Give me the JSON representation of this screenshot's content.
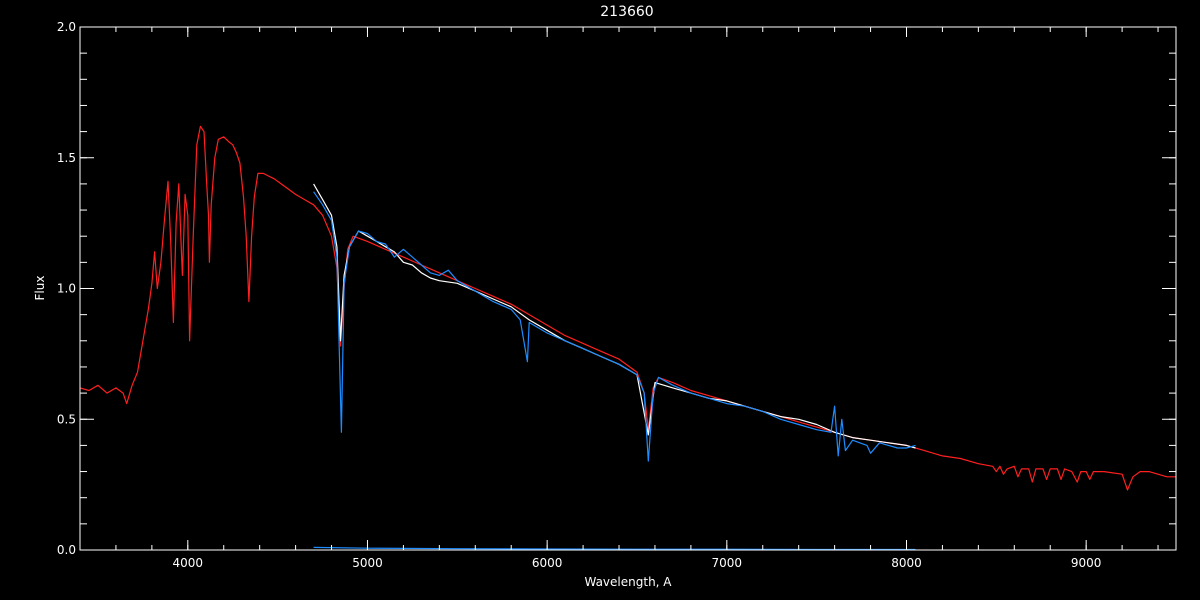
{
  "chart_data": {
    "type": "line",
    "title": "213660",
    "xlabel": "Wavelength, A",
    "ylabel": "Flux",
    "xlim": [
      3400,
      9500
    ],
    "ylim": [
      0.0,
      2.0
    ],
    "x_ticks": [
      4000,
      5000,
      6000,
      7000,
      8000,
      9000
    ],
    "x_tick_labels": [
      "4000",
      "5000",
      "6000",
      "7000",
      "8000",
      "9000"
    ],
    "y_ticks": [
      0.0,
      0.5,
      1.0,
      1.5,
      2.0
    ],
    "y_tick_labels": [
      "0.0",
      "0.5",
      "1.0",
      "1.5",
      "2.0"
    ],
    "x_minor_step": 200,
    "y_minor_step": 0.1,
    "grid": false,
    "background": "#000000",
    "axis_color": "#ffffff",
    "series": [
      {
        "color": "#ff2020",
        "points": [
          [
            3400,
            0.62
          ],
          [
            3450,
            0.61
          ],
          [
            3500,
            0.63
          ],
          [
            3550,
            0.6
          ],
          [
            3600,
            0.62
          ],
          [
            3640,
            0.6
          ],
          [
            3660,
            0.56
          ],
          [
            3690,
            0.63
          ],
          [
            3720,
            0.68
          ],
          [
            3750,
            0.8
          ],
          [
            3780,
            0.92
          ],
          [
            3800,
            1.02
          ],
          [
            3815,
            1.14
          ],
          [
            3830,
            1.0
          ],
          [
            3850,
            1.1
          ],
          [
            3870,
            1.26
          ],
          [
            3890,
            1.41
          ],
          [
            3905,
            1.18
          ],
          [
            3920,
            0.87
          ],
          [
            3935,
            1.25
          ],
          [
            3950,
            1.4
          ],
          [
            3962,
            1.18
          ],
          [
            3970,
            1.05
          ],
          [
            3985,
            1.36
          ],
          [
            4000,
            1.28
          ],
          [
            4010,
            0.8
          ],
          [
            4030,
            1.2
          ],
          [
            4050,
            1.55
          ],
          [
            4070,
            1.62
          ],
          [
            4090,
            1.6
          ],
          [
            4105,
            1.4
          ],
          [
            4115,
            1.28
          ],
          [
            4120,
            1.1
          ],
          [
            4130,
            1.32
          ],
          [
            4150,
            1.5
          ],
          [
            4170,
            1.57
          ],
          [
            4200,
            1.58
          ],
          [
            4230,
            1.56
          ],
          [
            4250,
            1.55
          ],
          [
            4270,
            1.52
          ],
          [
            4290,
            1.48
          ],
          [
            4310,
            1.35
          ],
          [
            4325,
            1.2
          ],
          [
            4340,
            0.95
          ],
          [
            4355,
            1.2
          ],
          [
            4370,
            1.35
          ],
          [
            4390,
            1.44
          ],
          [
            4420,
            1.44
          ],
          [
            4450,
            1.43
          ],
          [
            4480,
            1.42
          ],
          [
            4520,
            1.4
          ],
          [
            4560,
            1.38
          ],
          [
            4600,
            1.36
          ],
          [
            4650,
            1.34
          ],
          [
            4700,
            1.32
          ],
          [
            4750,
            1.28
          ],
          [
            4800,
            1.2
          ],
          [
            4830,
            1.08
          ],
          [
            4850,
            0.78
          ],
          [
            4870,
            1.0
          ],
          [
            4890,
            1.15
          ],
          [
            4920,
            1.2
          ],
          [
            4960,
            1.19
          ],
          [
            5000,
            1.18
          ],
          [
            5100,
            1.15
          ],
          [
            5200,
            1.12
          ],
          [
            5300,
            1.09
          ],
          [
            5400,
            1.06
          ],
          [
            5500,
            1.03
          ],
          [
            5600,
            1.0
          ],
          [
            5700,
            0.97
          ],
          [
            5800,
            0.94
          ],
          [
            5900,
            0.9
          ],
          [
            6000,
            0.86
          ],
          [
            6100,
            0.82
          ],
          [
            6200,
            0.79
          ],
          [
            6300,
            0.76
          ],
          [
            6400,
            0.73
          ],
          [
            6500,
            0.68
          ],
          [
            6540,
            0.6
          ],
          [
            6563,
            0.46
          ],
          [
            6590,
            0.62
          ],
          [
            6620,
            0.66
          ],
          [
            6700,
            0.64
          ],
          [
            6800,
            0.61
          ],
          [
            6900,
            0.59
          ],
          [
            7000,
            0.57
          ],
          [
            7100,
            0.55
          ],
          [
            7200,
            0.53
          ],
          [
            7300,
            0.51
          ],
          [
            7400,
            0.49
          ],
          [
            7500,
            0.47
          ],
          [
            7600,
            0.45
          ],
          [
            7700,
            0.43
          ],
          [
            7800,
            0.42
          ],
          [
            7900,
            0.41
          ],
          [
            8000,
            0.4
          ],
          [
            8100,
            0.38
          ],
          [
            8200,
            0.36
          ],
          [
            8300,
            0.35
          ],
          [
            8400,
            0.33
          ],
          [
            8480,
            0.32
          ],
          [
            8500,
            0.3
          ],
          [
            8520,
            0.32
          ],
          [
            8540,
            0.29
          ],
          [
            8560,
            0.31
          ],
          [
            8600,
            0.32
          ],
          [
            8620,
            0.28
          ],
          [
            8640,
            0.31
          ],
          [
            8680,
            0.31
          ],
          [
            8700,
            0.26
          ],
          [
            8720,
            0.31
          ],
          [
            8760,
            0.31
          ],
          [
            8780,
            0.27
          ],
          [
            8800,
            0.31
          ],
          [
            8840,
            0.31
          ],
          [
            8860,
            0.27
          ],
          [
            8880,
            0.31
          ],
          [
            8920,
            0.3
          ],
          [
            8950,
            0.26
          ],
          [
            8970,
            0.3
          ],
          [
            9000,
            0.3
          ],
          [
            9020,
            0.27
          ],
          [
            9040,
            0.3
          ],
          [
            9100,
            0.3
          ],
          [
            9200,
            0.29
          ],
          [
            9230,
            0.23
          ],
          [
            9260,
            0.28
          ],
          [
            9300,
            0.3
          ],
          [
            9350,
            0.3
          ],
          [
            9400,
            0.29
          ],
          [
            9450,
            0.28
          ],
          [
            9500,
            0.28
          ]
        ]
      },
      {
        "color": "#ffffff",
        "points": [
          [
            4700,
            1.4
          ],
          [
            4750,
            1.34
          ],
          [
            4800,
            1.28
          ],
          [
            4830,
            1.16
          ],
          [
            4850,
            0.8
          ],
          [
            4870,
            1.05
          ],
          [
            4900,
            1.16
          ],
          [
            4950,
            1.22
          ],
          [
            5000,
            1.2
          ],
          [
            5050,
            1.18
          ],
          [
            5100,
            1.16
          ],
          [
            5150,
            1.14
          ],
          [
            5200,
            1.1
          ],
          [
            5250,
            1.09
          ],
          [
            5300,
            1.06
          ],
          [
            5350,
            1.04
          ],
          [
            5400,
            1.03
          ],
          [
            5500,
            1.02
          ],
          [
            5600,
            0.99
          ],
          [
            5700,
            0.96
          ],
          [
            5800,
            0.93
          ],
          [
            5900,
            0.88
          ],
          [
            6000,
            0.84
          ],
          [
            6100,
            0.8
          ],
          [
            6200,
            0.77
          ],
          [
            6300,
            0.74
          ],
          [
            6400,
            0.71
          ],
          [
            6500,
            0.67
          ],
          [
            6563,
            0.44
          ],
          [
            6600,
            0.64
          ],
          [
            6700,
            0.62
          ],
          [
            6800,
            0.6
          ],
          [
            6900,
            0.58
          ],
          [
            7000,
            0.57
          ],
          [
            7100,
            0.55
          ],
          [
            7200,
            0.53
          ],
          [
            7300,
            0.51
          ],
          [
            7400,
            0.5
          ],
          [
            7500,
            0.48
          ],
          [
            7600,
            0.45
          ],
          [
            7700,
            0.43
          ],
          [
            7800,
            0.42
          ],
          [
            7900,
            0.41
          ],
          [
            8000,
            0.4
          ],
          [
            8050,
            0.39
          ]
        ]
      },
      {
        "color": "#1e8cff",
        "points": [
          [
            4700,
            1.37
          ],
          [
            4750,
            1.32
          ],
          [
            4800,
            1.26
          ],
          [
            4830,
            1.12
          ],
          [
            4855,
            0.45
          ],
          [
            4870,
            1.02
          ],
          [
            4900,
            1.16
          ],
          [
            4950,
            1.22
          ],
          [
            5000,
            1.21
          ],
          [
            5050,
            1.18
          ],
          [
            5100,
            1.17
          ],
          [
            5150,
            1.12
          ],
          [
            5200,
            1.15
          ],
          [
            5250,
            1.12
          ],
          [
            5300,
            1.09
          ],
          [
            5350,
            1.06
          ],
          [
            5400,
            1.05
          ],
          [
            5450,
            1.07
          ],
          [
            5500,
            1.03
          ],
          [
            5600,
            0.99
          ],
          [
            5700,
            0.95
          ],
          [
            5800,
            0.92
          ],
          [
            5850,
            0.88
          ],
          [
            5890,
            0.72
          ],
          [
            5900,
            0.87
          ],
          [
            6000,
            0.83
          ],
          [
            6100,
            0.8
          ],
          [
            6200,
            0.77
          ],
          [
            6300,
            0.74
          ],
          [
            6400,
            0.71
          ],
          [
            6500,
            0.67
          ],
          [
            6540,
            0.6
          ],
          [
            6563,
            0.34
          ],
          [
            6590,
            0.6
          ],
          [
            6620,
            0.66
          ],
          [
            6700,
            0.63
          ],
          [
            6800,
            0.6
          ],
          [
            6900,
            0.58
          ],
          [
            7000,
            0.56
          ],
          [
            7100,
            0.55
          ],
          [
            7200,
            0.53
          ],
          [
            7300,
            0.5
          ],
          [
            7400,
            0.48
          ],
          [
            7500,
            0.46
          ],
          [
            7580,
            0.45
          ],
          [
            7600,
            0.55
          ],
          [
            7620,
            0.36
          ],
          [
            7640,
            0.5
          ],
          [
            7660,
            0.38
          ],
          [
            7700,
            0.42
          ],
          [
            7780,
            0.4
          ],
          [
            7800,
            0.37
          ],
          [
            7850,
            0.41
          ],
          [
            7900,
            0.4
          ],
          [
            7950,
            0.39
          ],
          [
            8000,
            0.39
          ],
          [
            8050,
            0.4
          ]
        ]
      },
      {
        "color": "#1e8cff",
        "points": [
          [
            4700,
            0.01
          ],
          [
            5000,
            0.007
          ],
          [
            5500,
            0.005
          ],
          [
            6000,
            0.004
          ],
          [
            6500,
            0.003
          ],
          [
            7000,
            0.003
          ],
          [
            7500,
            0.002
          ],
          [
            8000,
            0.002
          ],
          [
            8050,
            0.002
          ]
        ]
      }
    ]
  }
}
